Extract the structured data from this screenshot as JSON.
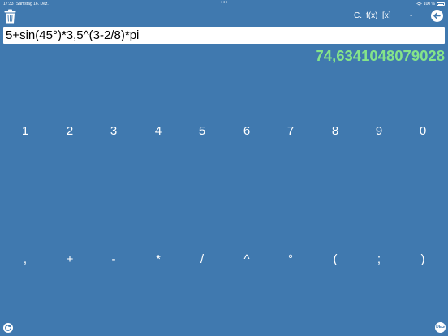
{
  "status_bar": {
    "time": "17:33",
    "date": "Samstag 16. Dez.",
    "dots": "•••",
    "battery_percent": "100 %"
  },
  "menu": {
    "clear_label": "C.",
    "function_label": "f(x)",
    "bracket_label": "[x]",
    "minus_label": "-"
  },
  "expression": "5+sin(45°)*3,5^(3-2/8)*pi",
  "result": "74,6341048079028",
  "digits": [
    "1",
    "2",
    "3",
    "4",
    "5",
    "6",
    "7",
    "8",
    "9",
    "0"
  ],
  "operators": [
    ",",
    "+",
    "-",
    "*",
    "/",
    "^",
    "°",
    "(",
    ";",
    ")"
  ],
  "colors": {
    "background": "#4079af",
    "result": "#84e48a",
    "input_background": "#ffffff"
  },
  "icons": {
    "trash": "trash-icon",
    "back": "arrow-left-icon",
    "refresh": "refresh-icon",
    "bottom_right": "deg-toggle-icon"
  },
  "bottom_right_label": "DEG"
}
